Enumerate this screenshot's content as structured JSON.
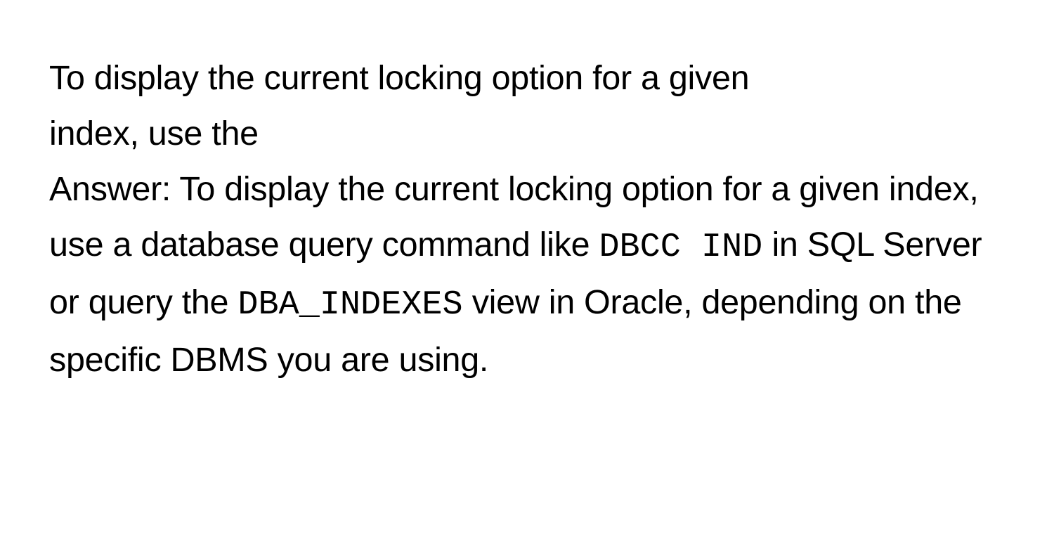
{
  "question": {
    "line1": "To display the current locking option for a given",
    "line2": "index, use the"
  },
  "answer": {
    "prefix": "Answer: ",
    "part1": "To display the current locking option for a given index, use a database query command like ",
    "code1": "DBCC IND",
    "part2": " in SQL Server or query the ",
    "code2": "DBA_INDEXES",
    "part3": " view in Oracle, depending on the specific DBMS you are using."
  }
}
